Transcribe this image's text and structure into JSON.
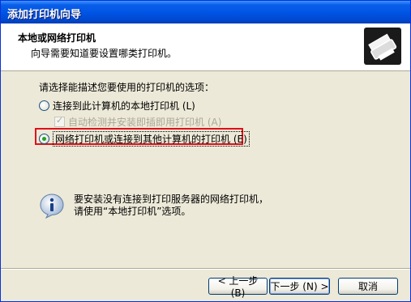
{
  "window": {
    "title": "添加打印机向导"
  },
  "header": {
    "title": "本地或网络打印机",
    "subtitle": "向导需要知道要设置哪类打印机。",
    "icon": "printer-icon"
  },
  "prompt": "请选择能描述您要使用的打印机的选项：",
  "options": {
    "local": {
      "label": "连接到此计算机的本地打印机 (L)",
      "checked": false
    },
    "auto_detect": {
      "label": "自动检测并安装即插即用打印机 (A)",
      "checked": true,
      "disabled": true
    },
    "network": {
      "label": "网络打印机或连接到其他计算机的打印机 (E)",
      "checked": true
    }
  },
  "info": {
    "icon": "info-icon",
    "line1": "要安装没有连接到打印服务器的网络打印机，",
    "line2": "请使用“本地打印机”选项。"
  },
  "buttons": {
    "back": "< 上一步 (B)",
    "next": "下一步 (N) >",
    "cancel": "取消"
  },
  "colors": {
    "titlebar": "#0055e5",
    "highlight": "#e0101a",
    "dialog_bg": "#ece9d8"
  }
}
